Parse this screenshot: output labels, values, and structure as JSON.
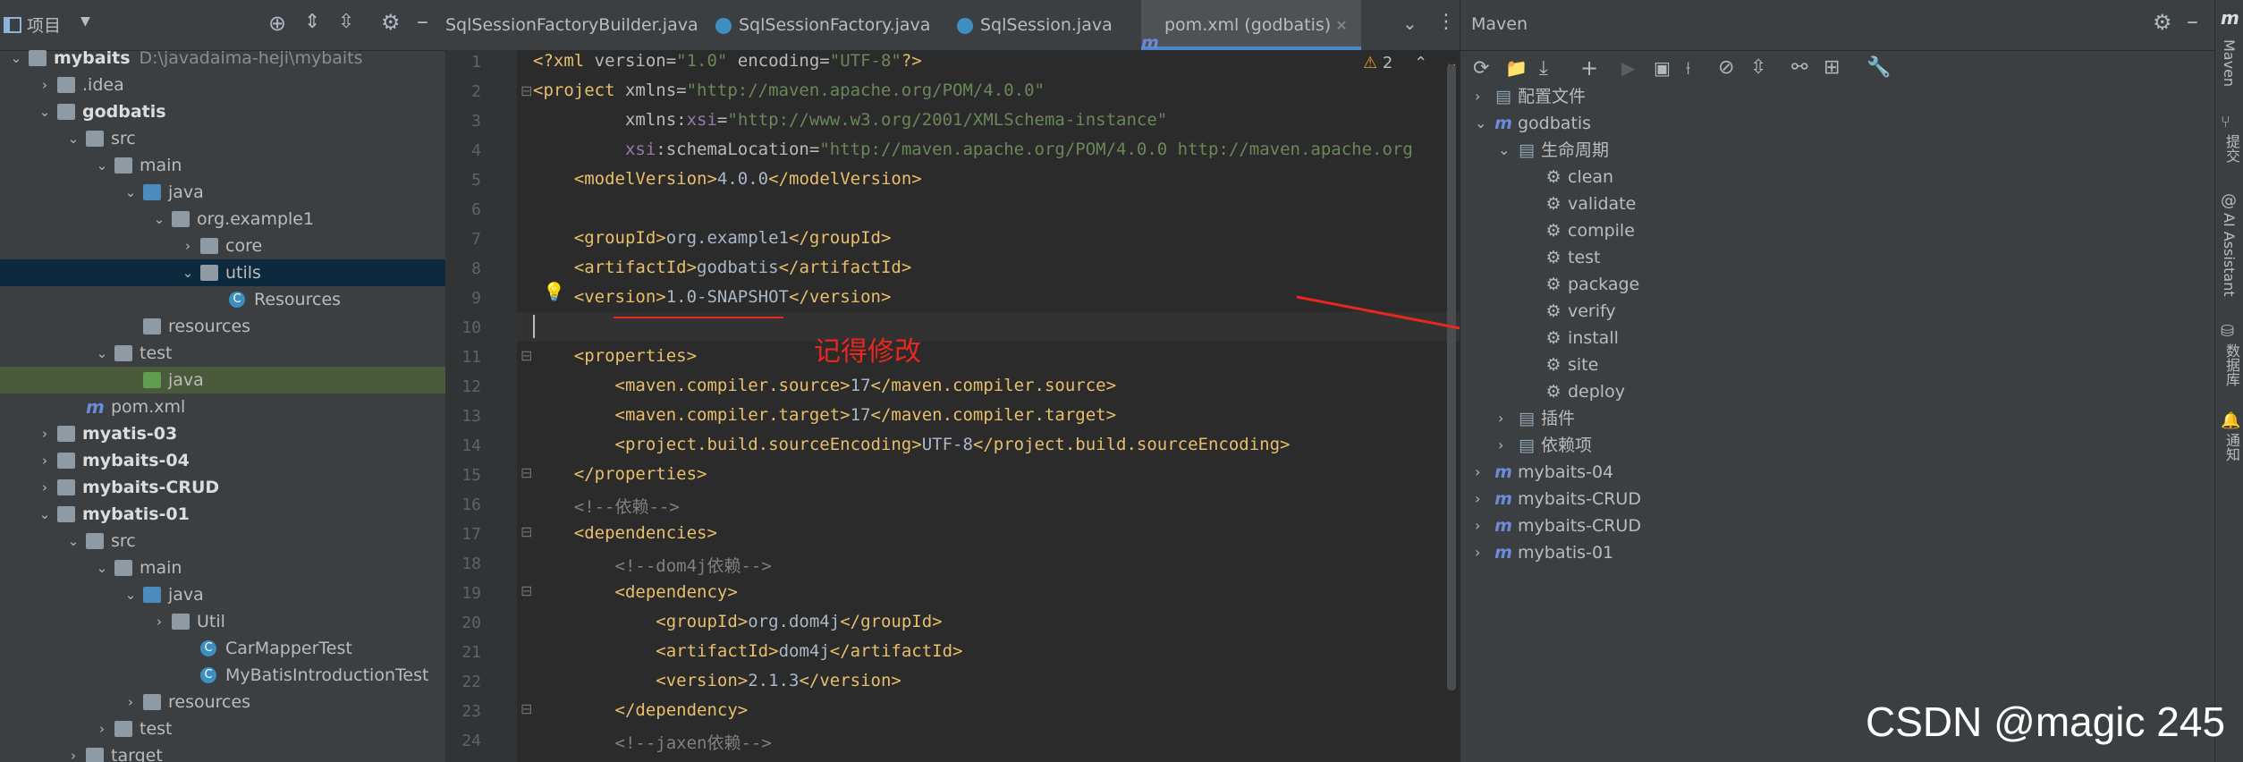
{
  "project": {
    "title": "项目",
    "tree": [
      {
        "label": "mybaits",
        "path": "D:\\javadaima-heji\\mybaits",
        "bold": true,
        "depth": 0,
        "arrow": "v",
        "icon": "module-folder"
      },
      {
        "label": ".idea",
        "depth": 1,
        "arrow": ">",
        "icon": "folder"
      },
      {
        "label": "godbatis",
        "bold": true,
        "depth": 1,
        "arrow": "v",
        "icon": "module-folder"
      },
      {
        "label": "src",
        "depth": 2,
        "arrow": "v",
        "icon": "folder"
      },
      {
        "label": "main",
        "depth": 3,
        "arrow": "v",
        "icon": "folder"
      },
      {
        "label": "java",
        "depth": 4,
        "arrow": "v",
        "icon": "source-folder"
      },
      {
        "label": "org.example1",
        "depth": 5,
        "arrow": "v",
        "icon": "package"
      },
      {
        "label": "core",
        "depth": 6,
        "arrow": ">",
        "icon": "package"
      },
      {
        "label": "utils",
        "depth": 6,
        "arrow": "v",
        "icon": "package",
        "selected": true
      },
      {
        "label": "Resources",
        "depth": 7,
        "arrow": "",
        "icon": "class"
      },
      {
        "label": "resources",
        "depth": 4,
        "arrow": "",
        "icon": "resources-folder"
      },
      {
        "label": "test",
        "depth": 3,
        "arrow": "v",
        "icon": "folder"
      },
      {
        "label": "java",
        "depth": 4,
        "arrow": "",
        "icon": "test-folder",
        "highlight": true
      },
      {
        "label": "pom.xml",
        "depth": 2,
        "arrow": "",
        "icon": "maven-file"
      },
      {
        "label": "myatis-03",
        "bold": true,
        "depth": 1,
        "arrow": ">",
        "icon": "module-folder"
      },
      {
        "label": "mybaits-04",
        "bold": true,
        "depth": 1,
        "arrow": ">",
        "icon": "module-folder"
      },
      {
        "label": "mybaits-CRUD",
        "bold": true,
        "depth": 1,
        "arrow": ">",
        "icon": "module-folder"
      },
      {
        "label": "mybatis-01",
        "bold": true,
        "depth": 1,
        "arrow": "v",
        "icon": "module-folder"
      },
      {
        "label": "src",
        "depth": 2,
        "arrow": "v",
        "icon": "folder"
      },
      {
        "label": "main",
        "depth": 3,
        "arrow": "v",
        "icon": "folder"
      },
      {
        "label": "java",
        "depth": 4,
        "arrow": "v",
        "icon": "source-folder"
      },
      {
        "label": "Util",
        "depth": 5,
        "arrow": ">",
        "icon": "package"
      },
      {
        "label": "CarMapperTest",
        "depth": 6,
        "arrow": "",
        "icon": "class"
      },
      {
        "label": "MyBatisIntroductionTest",
        "depth": 6,
        "arrow": "",
        "icon": "class"
      },
      {
        "label": "resources",
        "depth": 4,
        "arrow": ">",
        "icon": "resources-folder"
      },
      {
        "label": "test",
        "depth": 3,
        "arrow": ">",
        "icon": "folder"
      },
      {
        "label": "target",
        "depth": 2,
        "arrow": ">",
        "icon": "folder"
      }
    ]
  },
  "tabs": [
    {
      "label": "SqlSessionFactoryBuilder.java",
      "active": false
    },
    {
      "label": "SqlSessionFactory.java",
      "active": false
    },
    {
      "label": "SqlSession.java",
      "active": false
    },
    {
      "label": "pom.xml (godbatis)",
      "active": true
    }
  ],
  "editor": {
    "warning_count": "2",
    "lines": [
      {
        "n": "1",
        "html": "<span class='tag'>&lt;?xml </span><span class='attr'>version=</span><span class='val'>\"1.0\"</span><span class='attr'> encoding=</span><span class='val'>\"UTF-8\"</span><span class='tag'>?&gt;</span>"
      },
      {
        "n": "2",
        "html": "<span class='tag'>&lt;project </span><span class='attr'>xmlns=</span><span class='val'>\"http://maven.apache.org/POM/4.0.0\"</span>"
      },
      {
        "n": "3",
        "html": "         <span class='attr'>xmlns:</span><span class='ns'>xsi</span><span class='attr'>=</span><span class='val'>\"http://www.w3.org/2001/XMLSchema-instance\"</span>"
      },
      {
        "n": "4",
        "html": "         <span class='ns'>xsi</span><span class='attr'>:schemaLocation=</span><span class='val'>\"http://maven.apache.org/POM/4.0.0 http://maven.apache.org</span>"
      },
      {
        "n": "5",
        "html": "    <span class='tag'>&lt;modelVersion&gt;</span>4.0.0<span class='tag'>&lt;/modelVersion&gt;</span>"
      },
      {
        "n": "6",
        "html": ""
      },
      {
        "n": "7",
        "html": "    <span class='tag'>&lt;groupId&gt;</span>org.example1<span class='tag'>&lt;/groupId&gt;</span>"
      },
      {
        "n": "8",
        "html": "    <span class='tag'>&lt;artifactId&gt;</span>godbatis<span class='tag'>&lt;/artifactId&gt;</span>"
      },
      {
        "n": "9",
        "html": "    <span class='tag'>&lt;version&gt;</span>1.0-SNAPSHOT<span class='tag'>&lt;/version&gt;</span>"
      },
      {
        "n": "10",
        "html": ""
      },
      {
        "n": "11",
        "html": "    <span class='tag'>&lt;properties&gt;</span>"
      },
      {
        "n": "12",
        "html": "        <span class='tag'>&lt;maven.compiler.source&gt;</span>17<span class='tag'>&lt;/maven.compiler.source&gt;</span>"
      },
      {
        "n": "13",
        "html": "        <span class='tag'>&lt;maven.compiler.target&gt;</span>17<span class='tag'>&lt;/maven.compiler.target&gt;</span>"
      },
      {
        "n": "14",
        "html": "        <span class='tag'>&lt;project.build.sourceEncoding&gt;</span>UTF-8<span class='tag'>&lt;/project.build.sourceEncoding&gt;</span>"
      },
      {
        "n": "15",
        "html": "    <span class='tag'>&lt;/properties&gt;</span>"
      },
      {
        "n": "16",
        "html": "    <span class='cmt'>&lt;!--依赖--&gt;</span>"
      },
      {
        "n": "17",
        "html": "    <span class='tag'>&lt;dependencies&gt;</span>"
      },
      {
        "n": "18",
        "html": "        <span class='cmt'>&lt;!--dom4j依赖--&gt;</span>"
      },
      {
        "n": "19",
        "html": "        <span class='tag'>&lt;dependency&gt;</span>"
      },
      {
        "n": "20",
        "html": "            <span class='tag'>&lt;groupId&gt;</span>org.dom4j<span class='tag'>&lt;/groupId&gt;</span>"
      },
      {
        "n": "21",
        "html": "            <span class='tag'>&lt;artifactId&gt;</span>dom4j<span class='tag'>&lt;/artifactId&gt;</span>"
      },
      {
        "n": "22",
        "html": "            <span class='tag'>&lt;version&gt;</span>2.1.3<span class='tag'>&lt;/version&gt;</span>"
      },
      {
        "n": "23",
        "html": "        <span class='tag'>&lt;/dependency&gt;</span>"
      },
      {
        "n": "24",
        "html": "        <span class='cmt'>&lt;!--jaxen依赖--&gt;</span>"
      }
    ]
  },
  "maven": {
    "title": "Maven",
    "tree": [
      {
        "label": "配置文件",
        "depth": 0,
        "arrow": ">",
        "icon": "profiles"
      },
      {
        "label": "godbatis",
        "depth": 0,
        "arrow": "v",
        "icon": "maven-module"
      },
      {
        "label": "生命周期",
        "depth": 1,
        "arrow": "v",
        "icon": "lifecycle"
      },
      {
        "label": "clean",
        "depth": 2,
        "arrow": "",
        "icon": "gear"
      },
      {
        "label": "validate",
        "depth": 2,
        "arrow": "",
        "icon": "gear"
      },
      {
        "label": "compile",
        "depth": 2,
        "arrow": "",
        "icon": "gear"
      },
      {
        "label": "test",
        "depth": 2,
        "arrow": "",
        "icon": "gear"
      },
      {
        "label": "package",
        "depth": 2,
        "arrow": "",
        "icon": "gear"
      },
      {
        "label": "verify",
        "depth": 2,
        "arrow": "",
        "icon": "gear"
      },
      {
        "label": "install",
        "depth": 2,
        "arrow": "",
        "icon": "gear"
      },
      {
        "label": "site",
        "depth": 2,
        "arrow": "",
        "icon": "gear"
      },
      {
        "label": "deploy",
        "depth": 2,
        "arrow": "",
        "icon": "gear"
      },
      {
        "label": "插件",
        "depth": 1,
        "arrow": ">",
        "icon": "plugins"
      },
      {
        "label": "依赖项",
        "depth": 1,
        "arrow": ">",
        "icon": "dependencies"
      },
      {
        "label": "mybaits-04",
        "depth": 0,
        "arrow": ">",
        "icon": "maven-module"
      },
      {
        "label": "mybaits-CRUD",
        "depth": 0,
        "arrow": ">",
        "icon": "maven-module"
      },
      {
        "label": "mybaits-CRUD",
        "depth": 0,
        "arrow": ">",
        "icon": "maven-module"
      },
      {
        "label": "mybatis-01",
        "depth": 0,
        "arrow": ">",
        "icon": "maven-module"
      }
    ]
  },
  "right_strip": [
    "Maven",
    "提交",
    "AI Assistant",
    "数据库",
    "通知"
  ],
  "annotation": "记得修改",
  "watermark": "CSDN @magic 245"
}
